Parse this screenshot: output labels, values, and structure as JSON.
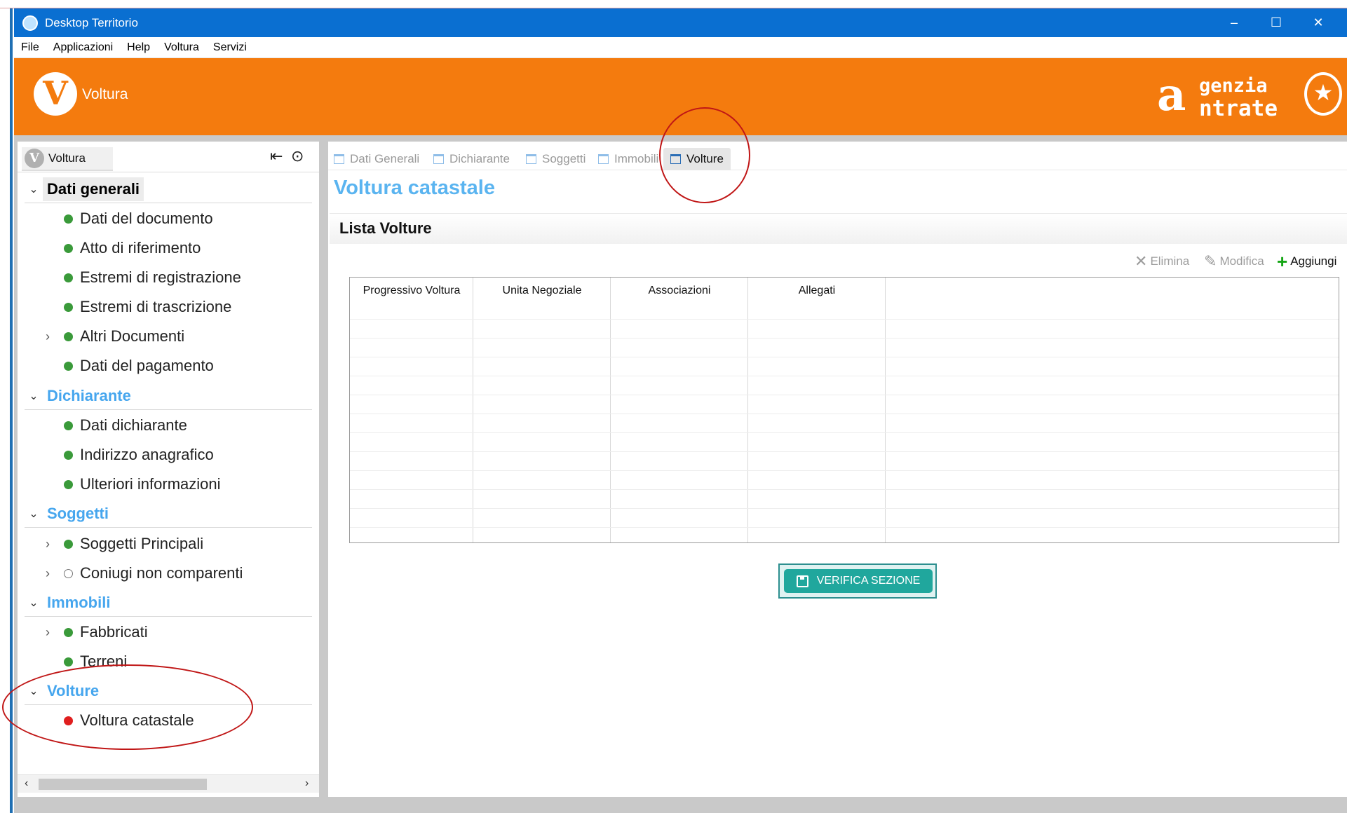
{
  "window": {
    "title": "Desktop Territorio",
    "controls": {
      "minimize": "–",
      "maximize": "☐",
      "close": "✕"
    }
  },
  "menu": [
    "File",
    "Applicazioni",
    "Help",
    "Voltura",
    "Servizi"
  ],
  "banner": {
    "logo_letter": "V",
    "app_name": "Voltura",
    "brand_big": "a",
    "brand_line1": "genzia",
    "brand_line2": "ntrate",
    "background": "#f47b0e"
  },
  "left_panel": {
    "tab_label": "Voltura",
    "tab_logo_letter": "V",
    "icons": [
      "exit-icon",
      "play-circle-icon"
    ],
    "sections": [
      {
        "title": "Dati generali",
        "active": true,
        "items": [
          {
            "label": "Dati del documento",
            "status": "green",
            "expandable": false
          },
          {
            "label": "Atto di riferimento",
            "status": "green",
            "expandable": false
          },
          {
            "label": "Estremi di registrazione",
            "status": "green",
            "expandable": false
          },
          {
            "label": "Estremi di trascrizione",
            "status": "green",
            "expandable": false
          },
          {
            "label": "Altri Documenti",
            "status": "green",
            "expandable": true
          },
          {
            "label": "Dati del pagamento",
            "status": "green",
            "expandable": false
          }
        ]
      },
      {
        "title": "Dichiarante",
        "active": false,
        "items": [
          {
            "label": "Dati dichiarante",
            "status": "green",
            "expandable": false
          },
          {
            "label": "Indirizzo anagrafico",
            "status": "green",
            "expandable": false
          },
          {
            "label": "Ulteriori informazioni",
            "status": "green",
            "expandable": false
          }
        ]
      },
      {
        "title": "Soggetti",
        "active": false,
        "items": [
          {
            "label": "Soggetti Principali",
            "status": "green",
            "expandable": true
          },
          {
            "label": "Coniugi non comparenti",
            "status": "empty",
            "expandable": true
          }
        ]
      },
      {
        "title": "Immobili",
        "active": false,
        "items": [
          {
            "label": "Fabbricati",
            "status": "green",
            "expandable": true
          },
          {
            "label": "Terreni",
            "status": "green",
            "expandable": false
          }
        ]
      },
      {
        "title": "Volture",
        "active": false,
        "items": [
          {
            "label": "Voltura catastale",
            "status": "red",
            "expandable": false
          }
        ]
      }
    ]
  },
  "main": {
    "tabs": [
      "Dati Generali",
      "Dichiarante",
      "Soggetti",
      "Immobili",
      "Volture"
    ],
    "active_tab": "Volture",
    "title": "Voltura catastale",
    "list_title": "Lista  Volture",
    "actions": {
      "delete": "Elimina",
      "edit": "Modifica",
      "add": "Aggiungi"
    },
    "table_columns": [
      "Progressivo Voltura",
      "Unita Negoziale",
      "Associazioni",
      "Allegati"
    ],
    "table_rows": [],
    "verify_button": "VERIFICA SEZIONE"
  },
  "colors": {
    "title_bar": "#0a6fd1",
    "orange": "#f47b0e",
    "section_blue": "#46a6ee",
    "status_green": "#3a9a3a",
    "status_red": "#e01e1e",
    "verify_teal": "#20a79d",
    "annotation_red": "#c01616"
  }
}
